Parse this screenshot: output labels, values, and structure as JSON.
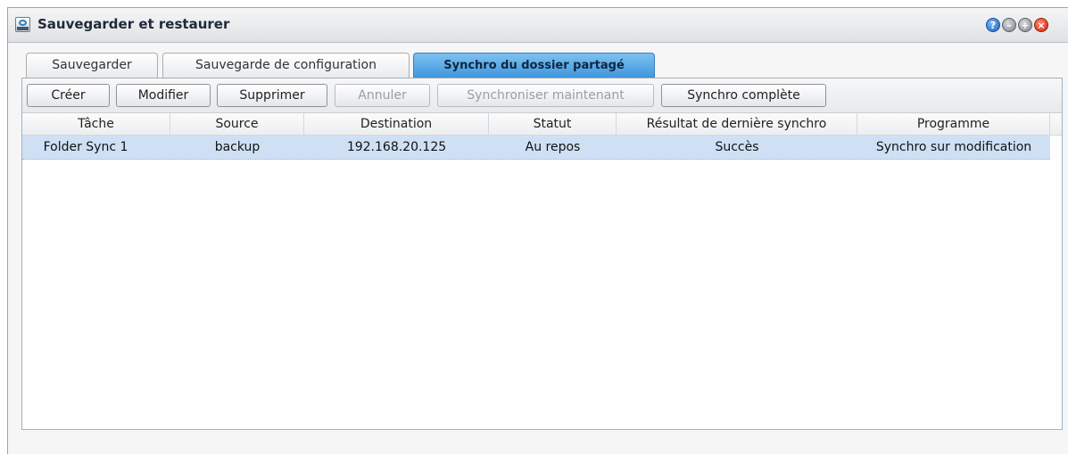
{
  "window": {
    "title": "Sauvegarder et restaurer"
  },
  "tabs": [
    {
      "label": "Sauvegarder",
      "active": false
    },
    {
      "label": "Sauvegarde de configuration",
      "active": false
    },
    {
      "label": "Synchro du dossier partagé",
      "active": true
    }
  ],
  "toolbar": {
    "create": "Créer",
    "modify": "Modifier",
    "delete": "Supprimer",
    "cancel": "Annuler",
    "sync_now": "Synchroniser maintenant",
    "full_sync": "Synchro complète"
  },
  "grid": {
    "columns": [
      "Tâche",
      "Source",
      "Destination",
      "Statut",
      "Résultat de dernière synchro",
      "Programme"
    ],
    "rows": [
      [
        "Folder Sync 1",
        "backup",
        "192.168.20.125",
        "Au repos",
        "Succès",
        "Synchro sur modification"
      ]
    ]
  },
  "colors": {
    "active_tab": "#3f95dc",
    "selected_row": "#cfe0f5"
  }
}
